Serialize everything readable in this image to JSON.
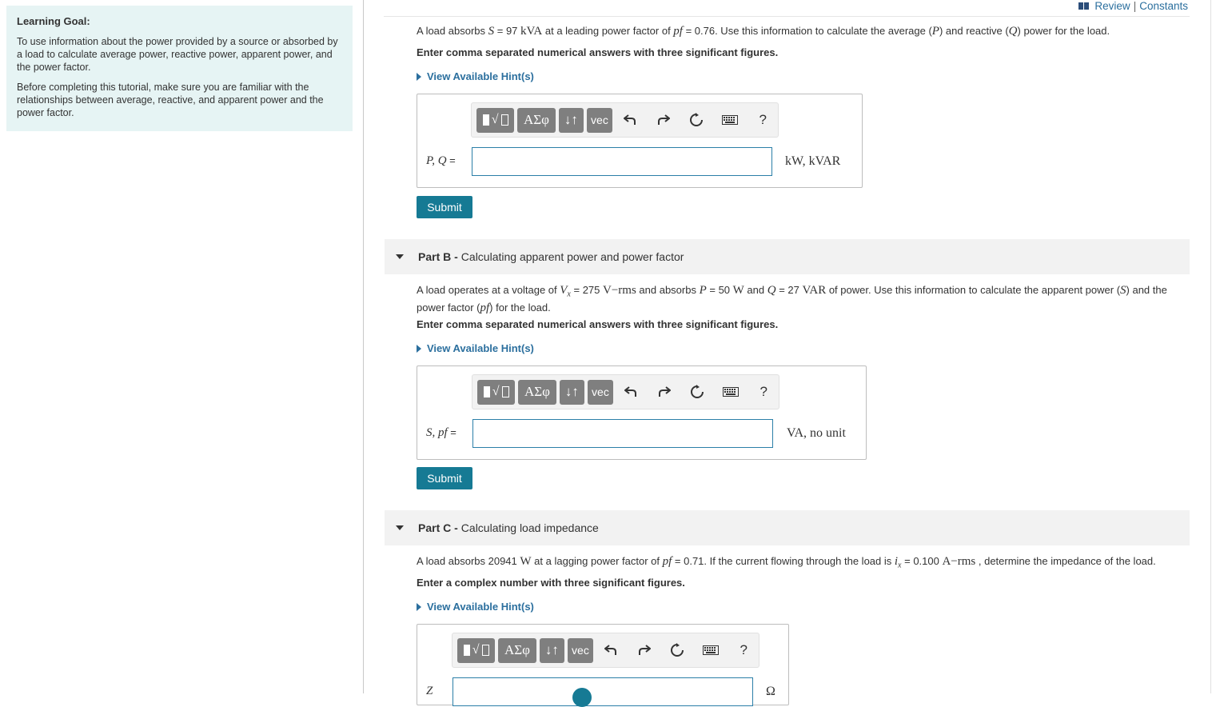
{
  "top_links": {
    "review": "Review",
    "separator": "|",
    "constants": "Constants"
  },
  "learning_goal": {
    "heading": "Learning Goal:",
    "p1": "To use information about the power provided by a source or absorbed by a load to calculate  average power, reactive power, apparent power, and the power factor.",
    "p2": "Before completing this tutorial, make sure you are familiar with the relationships between average, reactive, and apparent power and the power factor."
  },
  "toolbar": {
    "template_radical": "√",
    "greek": "ΑΣφ",
    "arrows": "↓↑",
    "vec": "vec",
    "help": "?"
  },
  "part_a": {
    "q_pre": "A load absorbs ",
    "S_var": "S",
    "eq1": " = 97 ",
    "S_unit": "kVA",
    "q_mid": " at a leading power factor of ",
    "pf_var": "pf",
    "eq2": " = 0.76. Use this information to calculate the average (",
    "P_var": "P",
    "q_and": ") and reactive (",
    "Q_var": "Q",
    "q_end": ") power for the load.",
    "instruction": "Enter comma separated numerical answers with three significant figures.",
    "hint": "View Available Hint(s)",
    "label": "P, Q",
    "eq": " =",
    "input_value": "",
    "unit": "kW, kVAR",
    "submit": "Submit"
  },
  "part_b": {
    "name": "Part B -",
    "title": "Calculating apparent power and power factor",
    "q_line1_pre": "A load operates at a voltage of ",
    "V_var": "V",
    "V_sub": "x",
    "v_val": " = 275 ",
    "V_unit": "V−rms",
    "q_abs": " and absorbs ",
    "P_var": "P",
    "p_val": " = 50 ",
    "W_unit": "W",
    "q_and": " and ",
    "Q_var": "Q",
    "q_val": " = 27 ",
    "VAR_unit": "VAR",
    "q_line1_end": " of power. Use this information to calculate the apparent power (",
    "S_var": "S",
    "q_line1_close": ") and the",
    "q_line2_pre": "power factor (",
    "pf_var": "pf",
    "q_line2_end": ") for the load.",
    "instruction": "Enter comma separated numerical answers with three significant figures.",
    "hint": "View Available Hint(s)",
    "label": "S, pf",
    "eq": " =",
    "input_value": "",
    "unit": "VA, no unit",
    "submit": "Submit"
  },
  "part_c": {
    "name": "Part C -",
    "title": "Calculating load impedance",
    "q_pre": "A load absorbs 20941 ",
    "W_unit": "W",
    "q_mid": "  at a lagging power factor of ",
    "pf_var": "pf",
    "pf_val": " = 0.71. If the current flowing through the load is ",
    "i_var": "i",
    "i_sub": "x",
    "i_val": " = 0.100 ",
    "A_unit": "A−rms",
    "q_end": " , determine the impedance of the load.",
    "instruction": "Enter a complex number with three significant figures.",
    "hint": "View Available Hint(s)",
    "label": "Z",
    "unit": "Ω",
    "input_value": ""
  }
}
